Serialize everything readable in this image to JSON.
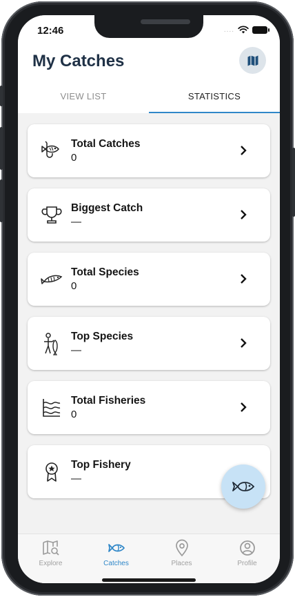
{
  "status_bar": {
    "time": "12:46",
    "signal_dots": "....",
    "wifi_icon": "wifi-icon",
    "battery_icon": "battery-icon"
  },
  "header": {
    "title": "My Catches",
    "map_button_icon": "map-icon"
  },
  "tabs": [
    {
      "label": "VIEW LIST",
      "active": false
    },
    {
      "label": "STATISTICS",
      "active": true
    }
  ],
  "stats": [
    {
      "label": "Total Catches",
      "value": "0",
      "icon": "fish-hook-icon"
    },
    {
      "label": "Biggest Catch",
      "value": "—",
      "icon": "trophy-icon"
    },
    {
      "label": "Total Species",
      "value": "0",
      "icon": "fish-icon"
    },
    {
      "label": "Top Species",
      "value": "—",
      "icon": "angler-icon"
    },
    {
      "label": "Total Fisheries",
      "value": "0",
      "icon": "waves-icon"
    },
    {
      "label": "Top Fishery",
      "value": "—",
      "icon": "award-icon"
    }
  ],
  "fab": {
    "icon": "add-catch-fish-icon"
  },
  "bottom_nav": [
    {
      "label": "Explore",
      "icon": "map-search-icon",
      "active": false
    },
    {
      "label": "Catches",
      "icon": "fish-icon",
      "active": true
    },
    {
      "label": "Places",
      "icon": "location-pin-icon",
      "active": false
    },
    {
      "label": "Profile",
      "icon": "profile-icon",
      "active": false
    }
  ],
  "colors": {
    "accent": "#2f87c8",
    "title": "#1f3146",
    "background": "#f2f2f2",
    "fab": "#c7e2f6"
  }
}
